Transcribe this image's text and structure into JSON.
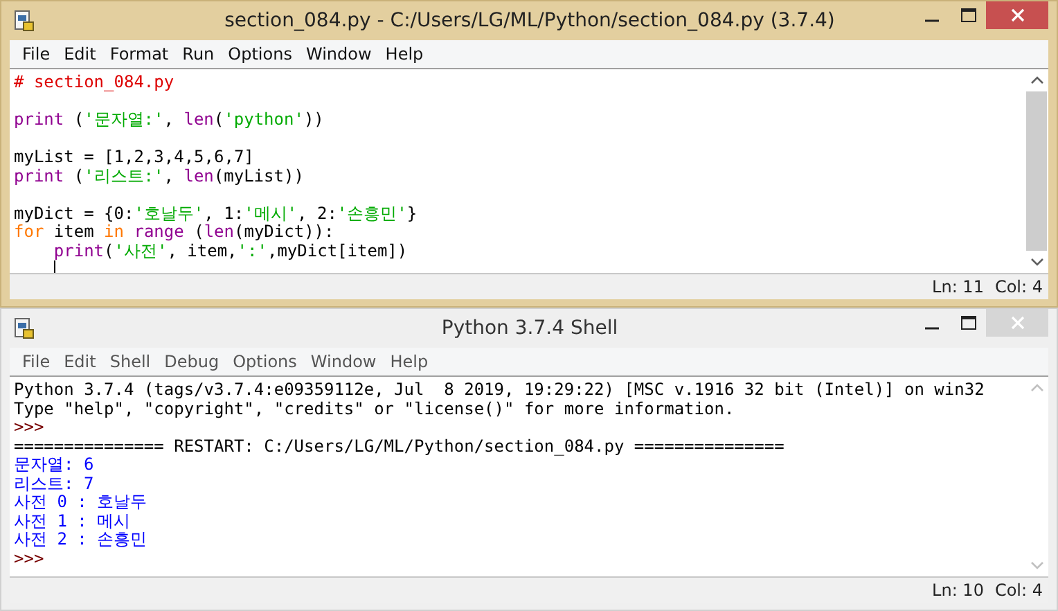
{
  "windows": [
    {
      "kind": "editor",
      "title": "section_084.py - C:/Users/LG/ML/Python/section_084.py (3.7.4)",
      "active": true,
      "menu": [
        "File",
        "Edit",
        "Format",
        "Run",
        "Options",
        "Window",
        "Help"
      ],
      "lines": [
        {
          "tokens": [
            {
              "kind": "comment",
              "text": "# section_084.py"
            }
          ]
        },
        {
          "blank_before": true,
          "tokens": [
            {
              "kind": "builtin",
              "text": "print"
            },
            {
              "kind": "plain",
              "text": " ("
            },
            {
              "kind": "string",
              "text": "'문자열:'"
            },
            {
              "kind": "plain",
              "text": ", "
            },
            {
              "kind": "builtin",
              "text": "len"
            },
            {
              "kind": "plain",
              "text": "("
            },
            {
              "kind": "string",
              "text": "'python'"
            },
            {
              "kind": "plain",
              "text": "))"
            }
          ]
        },
        {
          "blank_before": true,
          "tokens": [
            {
              "kind": "plain",
              "text": "myList = [1,2,3,4,5,6,7]"
            }
          ]
        },
        {
          "tokens": [
            {
              "kind": "builtin",
              "text": "print"
            },
            {
              "kind": "plain",
              "text": " ("
            },
            {
              "kind": "string",
              "text": "'리스트:'"
            },
            {
              "kind": "plain",
              "text": ", "
            },
            {
              "kind": "builtin",
              "text": "len"
            },
            {
              "kind": "plain",
              "text": "(myList))"
            }
          ]
        },
        {
          "blank_before": true,
          "tokens": [
            {
              "kind": "plain",
              "text": "myDict = {0:"
            },
            {
              "kind": "string",
              "text": "'호날두'"
            },
            {
              "kind": "plain",
              "text": ", 1:"
            },
            {
              "kind": "string",
              "text": "'메시'"
            },
            {
              "kind": "plain",
              "text": ", 2:"
            },
            {
              "kind": "string",
              "text": "'손흥민'"
            },
            {
              "kind": "plain",
              "text": "}"
            }
          ]
        },
        {
          "tokens": [
            {
              "kind": "keyword",
              "text": "for"
            },
            {
              "kind": "plain",
              "text": " item "
            },
            {
              "kind": "keyword",
              "text": "in"
            },
            {
              "kind": "builtin",
              "text": " range"
            },
            {
              "kind": "plain",
              "text": " ("
            },
            {
              "kind": "builtin",
              "text": "len"
            },
            {
              "kind": "plain",
              "text": "(myDict)):"
            }
          ]
        },
        {
          "indent": true,
          "tokens": [
            {
              "kind": "builtin",
              "text": "print"
            },
            {
              "kind": "plain",
              "text": "("
            },
            {
              "kind": "string",
              "text": "'사전'"
            },
            {
              "kind": "plain",
              "text": ", item,"
            },
            {
              "kind": "string",
              "text": "':'"
            },
            {
              "kind": "plain",
              "text": ",myDict[item])"
            }
          ]
        },
        {
          "indent": true,
          "cursor": true
        }
      ],
      "status": [
        "Ln: 11",
        "Col: 4"
      ]
    },
    {
      "kind": "shell",
      "title": "Python 3.7.4 Shell",
      "active": false,
      "menu": [
        "File",
        "Edit",
        "Shell",
        "Debug",
        "Options",
        "Window",
        "Help"
      ],
      "lines": [
        {
          "tokens": [
            {
              "kind": "plain",
              "text": "Python 3.7.4 (tags/v3.7.4:e09359112e, Jul  8 2019, 19:29:22) [MSC v.1916 32 bit (Intel)] on win32"
            }
          ]
        },
        {
          "tokens": [
            {
              "kind": "plain",
              "text": "Type \"help\", \"copyright\", \"credits\" or \"license()\" for more information."
            }
          ]
        },
        {
          "tokens": [
            {
              "kind": "prompt",
              "text": ">>>"
            }
          ]
        },
        {
          "tokens": [
            {
              "kind": "plain",
              "text": "=============== RESTART: C:/Users/LG/ML/Python/section_084.py ==============="
            }
          ]
        },
        {
          "tokens": [
            {
              "kind": "stdout",
              "text": "문자열: 6"
            }
          ]
        },
        {
          "tokens": [
            {
              "kind": "stdout",
              "text": "리스트: 7"
            }
          ]
        },
        {
          "tokens": [
            {
              "kind": "stdout",
              "text": "사전 0 : 호날두"
            }
          ]
        },
        {
          "tokens": [
            {
              "kind": "stdout",
              "text": "사전 1 : 메시"
            }
          ]
        },
        {
          "tokens": [
            {
              "kind": "stdout",
              "text": "사전 2 : 손흥민"
            }
          ]
        },
        {
          "tokens": [
            {
              "kind": "prompt",
              "text": ">>>"
            }
          ]
        }
      ],
      "status": [
        "Ln: 10",
        "Col: 4"
      ]
    }
  ]
}
